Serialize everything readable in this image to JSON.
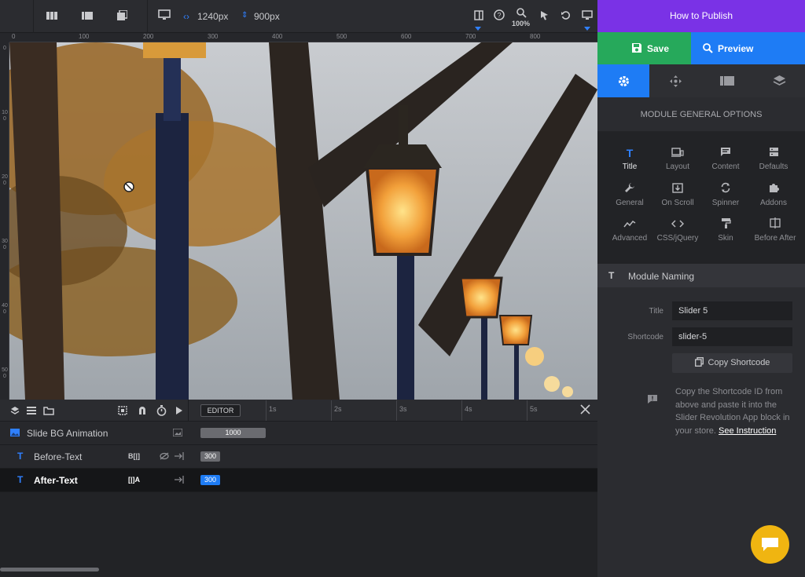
{
  "toolbar": {
    "width_value": "1240px",
    "height_value": "900px",
    "zoom": "100%"
  },
  "ruler": {
    "top_labels": [
      "0",
      "100",
      "200",
      "300",
      "400",
      "500",
      "600",
      "700",
      "800"
    ],
    "left_labels": [
      "0",
      "100",
      "200",
      "300",
      "400",
      "500"
    ]
  },
  "timeline": {
    "editor_label": "EDITOR",
    "time_marks": [
      "1s",
      "2s",
      "3s",
      "4s",
      "5s"
    ],
    "rows": [
      {
        "name": "Slide BG Animation",
        "bar": "1000"
      },
      {
        "name": "Before-Text",
        "tag": "B[|]",
        "bar": "300"
      },
      {
        "name": "After-Text",
        "tag": "[|]A",
        "bar": "300"
      }
    ]
  },
  "panel": {
    "publish": "How to Publish",
    "save": "Save",
    "preview": "Preview",
    "section_title": "MODULE GENERAL OPTIONS",
    "options": [
      {
        "label": "Title",
        "icon": "title-icon"
      },
      {
        "label": "Layout",
        "icon": "layout-icon"
      },
      {
        "label": "Content",
        "icon": "content-icon"
      },
      {
        "label": "Defaults",
        "icon": "defaults-icon"
      },
      {
        "label": "General",
        "icon": "wrench-icon"
      },
      {
        "label": "On Scroll",
        "icon": "scroll-icon"
      },
      {
        "label": "Spinner",
        "icon": "spinner-icon"
      },
      {
        "label": "Addons",
        "icon": "puzzle-icon"
      },
      {
        "label": "Advanced",
        "icon": "advanced-icon"
      },
      {
        "label": "CSS/jQuery",
        "icon": "code-icon"
      },
      {
        "label": "Skin",
        "icon": "paint-roller-icon"
      },
      {
        "label": "Before After",
        "icon": "before-after-icon"
      }
    ],
    "naming": {
      "header": "Module Naming",
      "title_label": "Title",
      "title_value": "Slider 5",
      "shortcode_label": "Shortcode",
      "shortcode_value": "slider-5",
      "copy_button": "Copy Shortcode",
      "note": "Copy the Shortcode ID from above and paste it into the Slider Revolution App block in your store.",
      "note_link": "See Instruction"
    }
  },
  "colors": {
    "accent_blue": "#2f80ff",
    "publish_purple": "#7a32e6",
    "save_green": "#26a95b",
    "preview_blue": "#1e7cf5",
    "chat_yellow": "#f0b511"
  }
}
